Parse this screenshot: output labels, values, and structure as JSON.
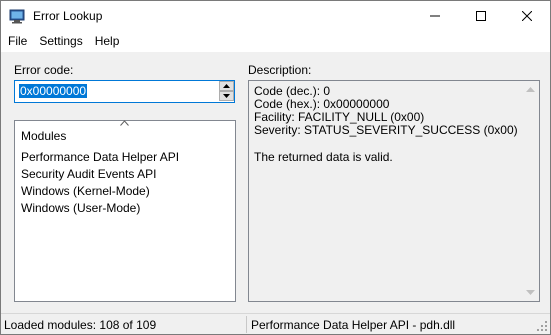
{
  "window": {
    "title": "Error Lookup",
    "icon": "monitor-icon"
  },
  "menu": {
    "items": [
      "File",
      "Settings",
      "Help"
    ]
  },
  "error_code": {
    "label": "Error code:",
    "value": "0x00000000"
  },
  "modules": {
    "header": "Modules",
    "items": [
      "Performance Data Helper API",
      "Security Audit Events API",
      "Windows (Kernel-Mode)",
      "Windows (User-Mode)"
    ]
  },
  "description": {
    "label": "Description:",
    "lines": [
      "Code (dec.): 0",
      "Code (hex.): 0x00000000",
      "Facility: FACILITY_NULL (0x00)",
      "Severity: STATUS_SEVERITY_SUCCESS (0x00)"
    ],
    "message": "The returned data is valid."
  },
  "status": {
    "loaded_modules": "Loaded modules: 108 of 109",
    "current_module": "Performance Data Helper API - pdh.dll"
  },
  "colors": {
    "accent": "#0078d7",
    "window_bg": "#f0f0f0",
    "border": "#828790"
  }
}
